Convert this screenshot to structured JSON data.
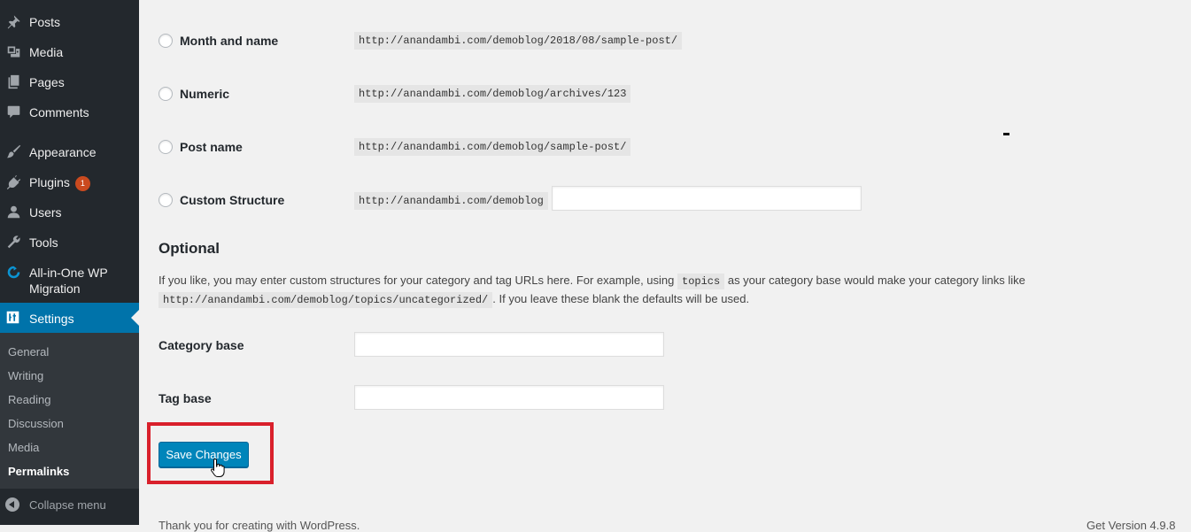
{
  "sidebar": {
    "items": [
      {
        "label": "Posts",
        "icon": "pin-icon"
      },
      {
        "label": "Media",
        "icon": "media-icon"
      },
      {
        "label": "Pages",
        "icon": "pages-icon"
      },
      {
        "label": "Comments",
        "icon": "comment-icon"
      },
      {
        "label": "Appearance",
        "icon": "brush-icon"
      },
      {
        "label": "Plugins",
        "icon": "plugin-icon",
        "badge": "1"
      },
      {
        "label": "Users",
        "icon": "user-icon"
      },
      {
        "label": "Tools",
        "icon": "wrench-icon"
      },
      {
        "label_line1": "All-in-One WP",
        "label_line2": "Migration",
        "icon": "migration-icon"
      }
    ],
    "settings_label": "Settings",
    "submenu": [
      "General",
      "Writing",
      "Reading",
      "Discussion",
      "Media",
      "Permalinks"
    ],
    "current_submenu": "Permalinks",
    "collapse_label": "Collapse menu",
    "accent_color": "#0073aa",
    "badge_color": "#ca4a1f"
  },
  "permalink_options": [
    {
      "label": "Month and name",
      "example": "http://anandambi.com/demoblog/2018/08/sample-post/"
    },
    {
      "label": "Numeric",
      "example": "http://anandambi.com/demoblog/archives/123"
    },
    {
      "label": "Post name",
      "example": "http://anandambi.com/demoblog/sample-post/"
    },
    {
      "label": "Custom Structure",
      "example": "http://anandambi.com/demoblog",
      "value": ""
    }
  ],
  "optional": {
    "heading": "Optional",
    "desc_part1": "If you like, you may enter custom structures for your category and tag URLs here. For example, using",
    "desc_code1": "topics",
    "desc_part2": "as your category base would make your category links like",
    "desc_code2": "http://anandambi.com/demoblog/topics/uncategorized/",
    "desc_part3": ". If you leave these blank the defaults will be used.",
    "category_base_label": "Category base",
    "category_base_value": "",
    "tag_base_label": "Tag base",
    "tag_base_value": ""
  },
  "save_button_label": "Save Changes",
  "highlight_color": "#d9202b",
  "footer": {
    "left": "Thank you for creating with WordPress.",
    "right": "Get Version 4.9.8"
  }
}
